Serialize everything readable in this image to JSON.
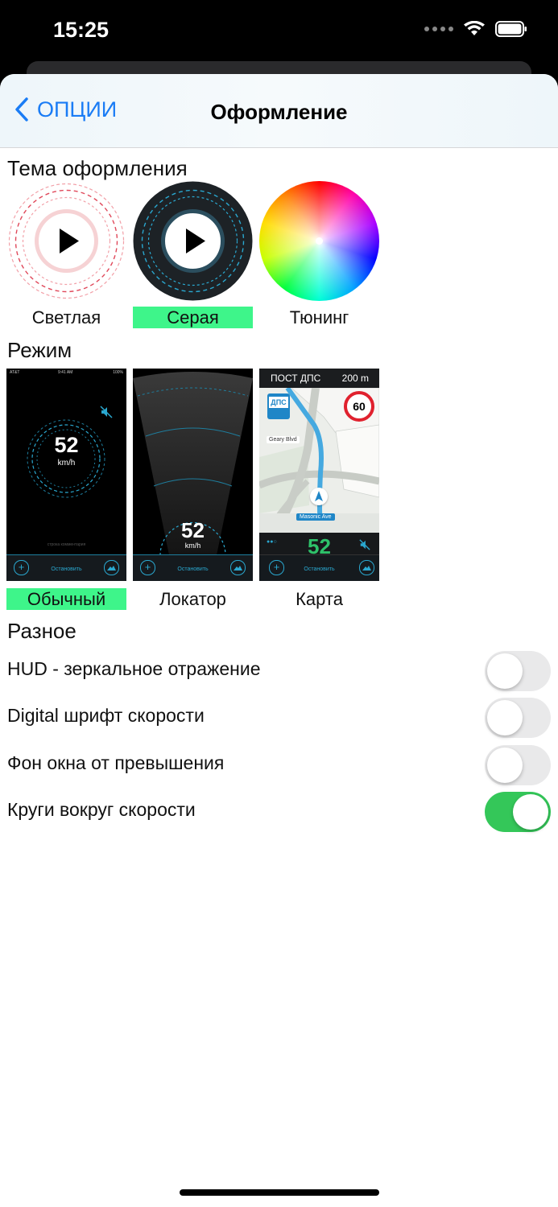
{
  "status_bar": {
    "time": "15:25"
  },
  "nav": {
    "back_label": "ОПЦИИ",
    "title": "Оформление"
  },
  "theme_section": {
    "title": "Тема оформления",
    "items": [
      {
        "label": "Светлая",
        "selected": false,
        "icon": "light-theme-icon"
      },
      {
        "label": "Серая",
        "selected": true,
        "icon": "gray-theme-icon"
      },
      {
        "label": "Тюнинг",
        "selected": false,
        "icon": "color-wheel-icon"
      }
    ]
  },
  "mode_section": {
    "title": "Режим",
    "items": [
      {
        "label": "Обычный",
        "selected": true
      },
      {
        "label": "Локатор",
        "selected": false
      },
      {
        "label": "Карта",
        "selected": false
      }
    ],
    "preview": {
      "carrier": "AT&T",
      "clock": "9:41 AM",
      "battery": "100%",
      "speed": "52",
      "unit": "km/h",
      "comment": "строка комментария",
      "stop_label": "Остановить",
      "map_banner": "ПОСТ ДПС",
      "map_distance": "200 m",
      "map_badge": "ДПС",
      "speed_limit": "60",
      "street_1": "Geary Blvd",
      "street_2": "Masonic Ave"
    }
  },
  "misc_section": {
    "title": "Разное",
    "settings": [
      {
        "label": "HUD - зеркальное отражение",
        "enabled": false
      },
      {
        "label": "Digital шрифт скорости",
        "enabled": false
      },
      {
        "label": "Фон окна от превышения",
        "enabled": false
      },
      {
        "label": "Круги вокруг скорости",
        "enabled": true
      }
    ]
  },
  "colors": {
    "accent": "#1a7cf5",
    "selected_bg": "#3ef58a",
    "toggle_on": "#34c759",
    "toggle_off": "#e9e9ea",
    "speed_cyan": "#29b6d8",
    "map_speed_green": "#2ec16a"
  }
}
